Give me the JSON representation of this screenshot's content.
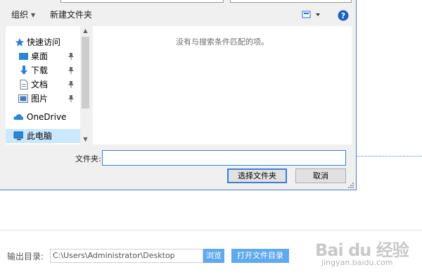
{
  "toolbar": {
    "organize_label": "组织",
    "new_folder_label": "新建文件夹"
  },
  "nav": {
    "items": [
      {
        "label": "快速访问",
        "icon": "star-icon",
        "pinned": false
      },
      {
        "label": "桌面",
        "icon": "desktop-icon",
        "pinned": true
      },
      {
        "label": "下载",
        "icon": "download-icon",
        "pinned": true
      },
      {
        "label": "文档",
        "icon": "document-icon",
        "pinned": true
      },
      {
        "label": "图片",
        "icon": "pictures-icon",
        "pinned": true
      },
      {
        "label": "OneDrive",
        "icon": "onedrive-icon",
        "pinned": false
      },
      {
        "label": "此电脑",
        "icon": "computer-icon",
        "pinned": false,
        "selected": true
      }
    ]
  },
  "content": {
    "empty_message": "没有与搜索条件匹配的项。"
  },
  "footer": {
    "folder_label": "文件夹:",
    "folder_value": "",
    "select_button": "选择文件夹",
    "cancel_button": "取消"
  },
  "app": {
    "output_label": "输出目录:",
    "output_path": "C:\\Users\\Administrator\\Desktop",
    "browse_button": "浏览",
    "open_dir_button": "打开文件目录"
  },
  "watermark": {
    "logo": "Bai du 经验",
    "url": "jingyan.baidu.com"
  },
  "colors": {
    "accent": "#3c7fd6",
    "button_blue": "#5fa9ef",
    "dialog_bg": "#f0f0f0"
  }
}
